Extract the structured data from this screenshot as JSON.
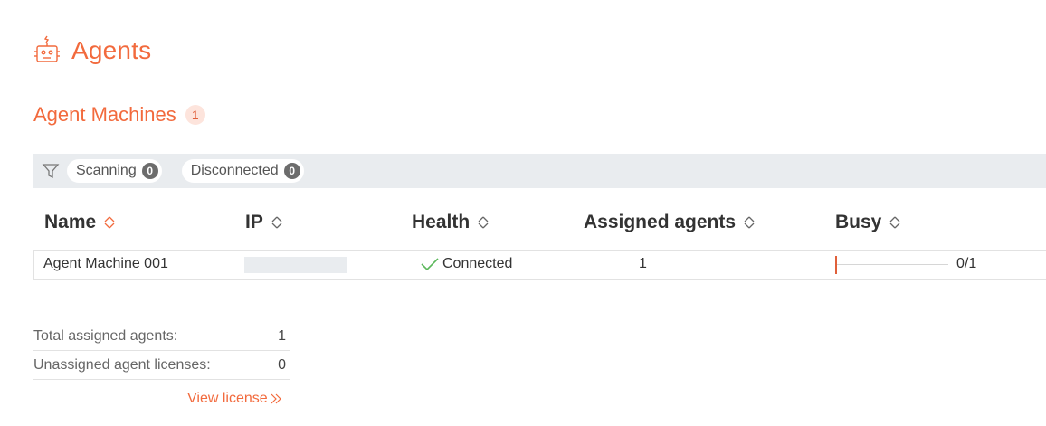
{
  "header": {
    "title": "Agents",
    "icon": "robot-icon"
  },
  "section": {
    "title": "Agent Machines",
    "count": "1"
  },
  "filters": [
    {
      "label": "Scanning",
      "count": "0"
    },
    {
      "label": "Disconnected",
      "count": "0"
    }
  ],
  "table": {
    "columns": [
      "Name",
      "IP",
      "Health",
      "Assigned agents",
      "Busy"
    ],
    "rows": [
      {
        "name": "Agent Machine 001",
        "ip": "",
        "health": "Connected",
        "assigned": "1",
        "busy": "0/1",
        "busy_fraction": 0
      }
    ]
  },
  "summary": {
    "rows": [
      {
        "label": "Total assigned agents:",
        "value": "1"
      },
      {
        "label": "Unassigned agent licenses:",
        "value": "0"
      }
    ],
    "link": "View license"
  },
  "colors": {
    "accent": "#f26a3d",
    "badge_bg": "#fde4dc",
    "filter_bg": "#e9ecef",
    "success": "#5cb85c"
  }
}
